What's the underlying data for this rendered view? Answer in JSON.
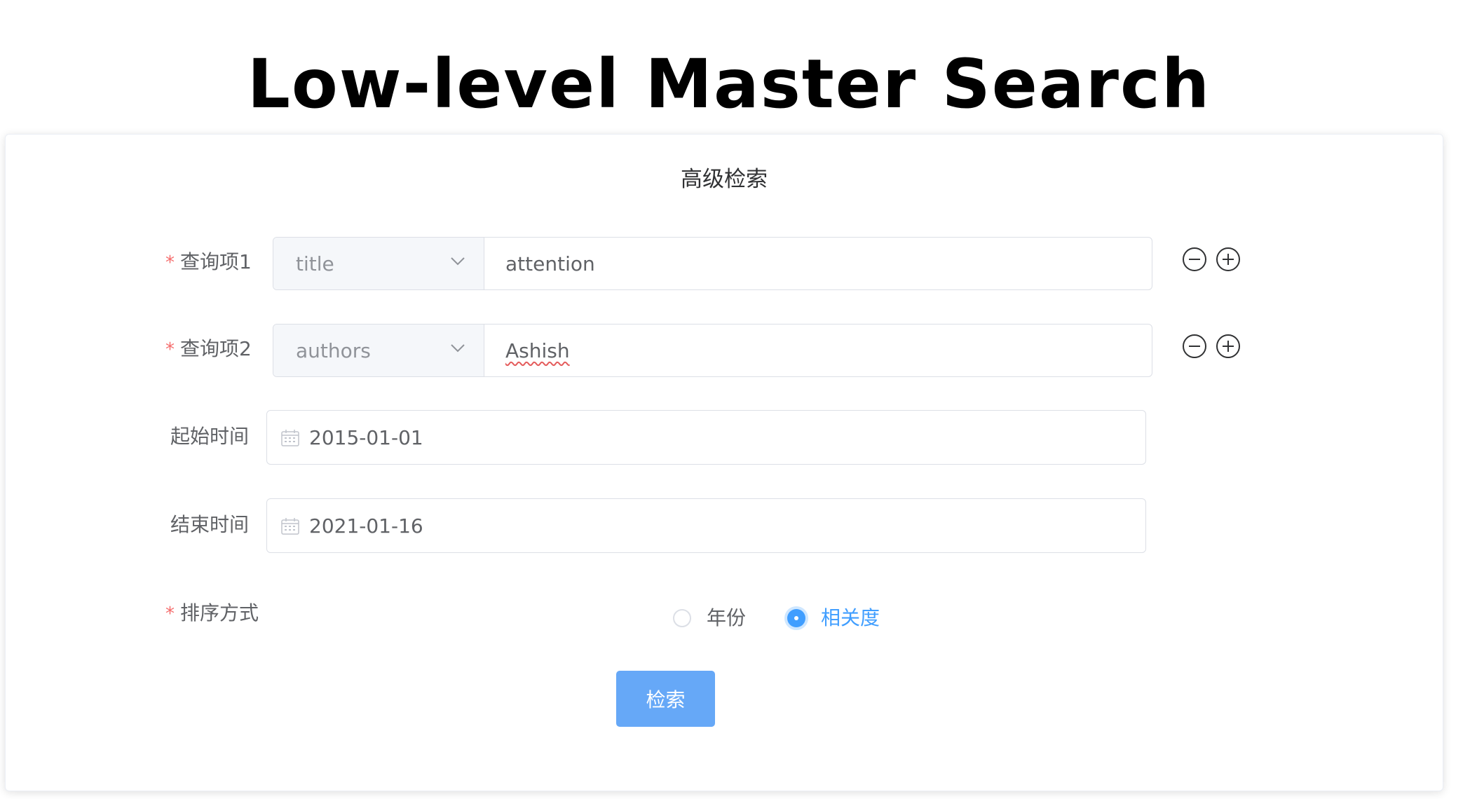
{
  "page": {
    "title": "Low-level Master Search"
  },
  "form": {
    "title": "高级检索",
    "required_marker": "*",
    "queries": [
      {
        "label": "查询项1",
        "field": "title",
        "value": "attention",
        "remove_icon": "minus-circle-icon",
        "add_icon": "plus-circle-icon"
      },
      {
        "label": "查询项2",
        "field": "authors",
        "value": "Ashish",
        "remove_icon": "minus-circle-icon",
        "add_icon": "plus-circle-icon"
      }
    ],
    "start_date": {
      "label": "起始时间",
      "value": "2015-01-01",
      "icon": "calendar-icon"
    },
    "end_date": {
      "label": "结束时间",
      "value": "2021-01-16",
      "icon": "calendar-icon"
    },
    "sort": {
      "label": "排序方式",
      "options": [
        "年份",
        "相关度"
      ],
      "selected": "相关度"
    },
    "submit_label": "检索"
  },
  "colors": {
    "accent": "#409eff",
    "button": "#66a8f7",
    "required": "#f56c6c",
    "border": "#dcdfe6",
    "select_background": "#f5f7fa"
  }
}
